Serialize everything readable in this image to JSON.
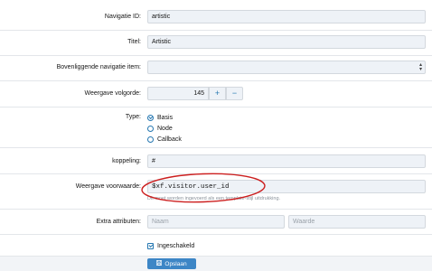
{
  "form": {
    "nav_id": {
      "label": "Navigatie ID:",
      "value": "artistic"
    },
    "title": {
      "label": "Titel:",
      "value": "Artistic"
    },
    "parent_nav": {
      "label": "Bovenliggende navigatie item:",
      "value": ""
    },
    "display_order": {
      "label": "Weergave volgorde:",
      "value": "145",
      "increment": "+",
      "decrement": "−"
    },
    "type": {
      "label": "Type:",
      "options": [
        "Basis",
        "Node",
        "Callback"
      ],
      "selected": "Basis"
    },
    "link": {
      "label": "koppeling:",
      "value": "#"
    },
    "display_condition": {
      "label": "Weergave voorwaarde:",
      "value": "$xf.visitor.user_id",
      "hint": "Dit moet worden ingevoerd als een template-stijl uitdrukking."
    },
    "extra_attributes": {
      "label": "Extra attributen:",
      "name_placeholder": "Naam",
      "value_placeholder": "Waarde"
    },
    "enabled": {
      "label": "Ingeschakeld",
      "checked": true
    }
  },
  "footer": {
    "save_label": "Opslaan",
    "save_icon": "save-icon"
  },
  "colors": {
    "accent": "#2577b1",
    "save_button": "#3d86c6",
    "annotation": "#cc1f1f"
  }
}
